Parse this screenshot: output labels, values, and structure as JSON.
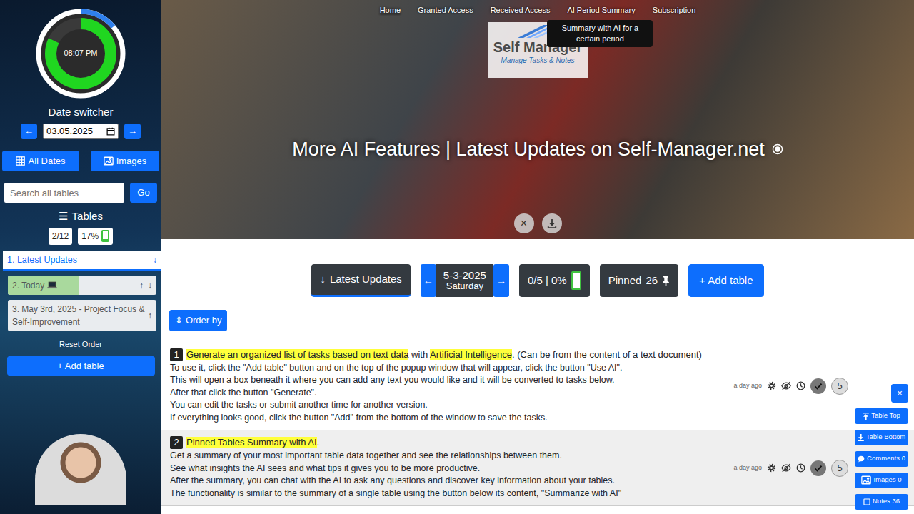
{
  "nav": [
    {
      "label": "Home",
      "selected": true
    },
    {
      "label": "Granted Access",
      "selected": false
    },
    {
      "label": "Received Access",
      "selected": false
    },
    {
      "label": "AI Period Summary",
      "selected": false
    },
    {
      "label": "Subscription",
      "selected": false
    }
  ],
  "tooltip": "Summary with AI for a certain period",
  "logo": {
    "title": "Self Manager",
    "subtitle": "Manage Tasks & Notes"
  },
  "hero": {
    "title": "More AI Features | Latest Updates on Self-Manager.net",
    "close": "×"
  },
  "sidebar": {
    "clock": {
      "time": "08:07 PM",
      "level": 0.82,
      "outer_level": 0.14
    },
    "date": {
      "label": "Date switcher",
      "prev": "←",
      "value": "03.05.2025",
      "next": "→"
    },
    "buttons": [
      "All Dates",
      "Images"
    ],
    "search": {
      "placeholder": "Search all tables",
      "button": "Go"
    },
    "tables": {
      "icon": "☰",
      "title": "Tables"
    },
    "stats": [
      {
        "label": "2/12"
      },
      {
        "label": "17%",
        "level": 0.17
      }
    ],
    "items": [
      {
        "label": "1. Latest Updates",
        "selected": true,
        "level": 0,
        "arrows": [
          "↓"
        ]
      },
      {
        "label": "2. Today",
        "selected": false,
        "level": 0.66,
        "arrows": [
          "↑",
          "↓"
        ]
      },
      {
        "label": "3. May 3rd, 2025 - Project Focus & Self-Improvement",
        "selected": false,
        "level": 0,
        "arrows": [
          "↑"
        ]
      }
    ],
    "reset": "Reset Order",
    "add": "+ Add table"
  },
  "toolbar": {
    "section": {
      "icon": "↓",
      "label": "Latest Updates"
    },
    "prev": "←",
    "date": "5-3-2025",
    "weekday": "Saturday",
    "next": "→",
    "progress": {
      "label": "0/5 | 0%",
      "level": 0
    },
    "pinned": {
      "label": "Pinned",
      "count": "26"
    },
    "add": "+ Add table"
  },
  "order_by": {
    "icon": "⇕",
    "label": "Order by"
  },
  "rows": [
    {
      "number": "1",
      "segments": [
        {
          "text": "Generate an organized list of tasks based on text data",
          "highlight": true
        },
        {
          "text": " with ",
          "highlight": false
        },
        {
          "text": "Artificial Intelligence",
          "highlight": true
        },
        {
          "text": ". (Can be from the content of a text document)",
          "highlight": false
        }
      ],
      "lines": [
        "To use it, click the \"Add table\" button and on the top of the popup window that will appear, click the button \"Use AI\".",
        "This will open a box beneath it where you can add any text you would like and it will be converted to tasks below.",
        "After that click the button \"Generate\".",
        "You can edit the tasks or submit another time for another version.",
        "If everything looks good, click the button \"Add\" from the bottom of the window to save the tasks."
      ],
      "time": "a day ago",
      "count": "5"
    },
    {
      "number": "2",
      "segments": [
        {
          "text": "Pinned Tables Summary with AI",
          "highlight": true
        },
        {
          "text": ".",
          "highlight": false
        }
      ],
      "lines": [
        "Get a summary of your most important table data together and see the relationships between them.",
        "See what insights the AI sees and what tips it gives you to be more productive.",
        "After the summary, you can chat with the AI to ask any questions and discover key information about your tables.",
        "The functionality is similar to the summary of a single table using the button below its content, \"Summarize with AI\""
      ],
      "time": "a day ago",
      "count": "5"
    }
  ],
  "float_buttons": [
    "×",
    "Table Top",
    "Table Bottom",
    "Comments 0",
    "Images 0",
    "Notes 36"
  ]
}
